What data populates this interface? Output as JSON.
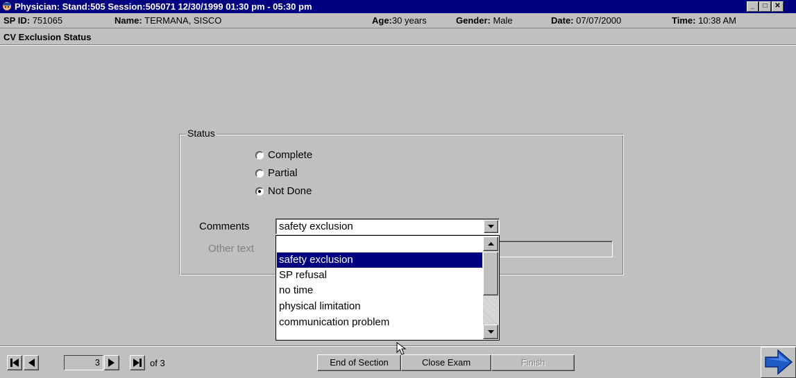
{
  "window": {
    "title": "Physician: Stand:505 Session:505071 12/30/1999 01:30 pm - 05:30 pm",
    "buttons": {
      "minimize": "_",
      "maximize": "□",
      "close": "✕"
    }
  },
  "info": {
    "sp_id_label": "SP ID:",
    "sp_id": "751065",
    "name_label": "Name:",
    "name": "TERMANA, SISCO",
    "age_label": "Age:",
    "age": "30 years",
    "gender_label": "Gender:",
    "gender": "Male",
    "date_label": "Date:",
    "date": "07/07/2000",
    "time_label": "Time:",
    "time": "10:38 AM"
  },
  "section": {
    "title": "CV Exclusion Status"
  },
  "status": {
    "legend": "Status",
    "options": [
      {
        "label": "Complete",
        "checked": false
      },
      {
        "label": "Partial",
        "checked": false
      },
      {
        "label": "Not Done",
        "checked": true
      }
    ]
  },
  "comments": {
    "label": "Comments",
    "value": "safety exclusion",
    "options": [
      "",
      "safety exclusion",
      "SP refusal",
      "no time",
      "physical limitation",
      "communication problem"
    ],
    "selected_index": 1
  },
  "other_text": {
    "label": "Other text"
  },
  "navigation": {
    "page": "3",
    "of_label": "of 3"
  },
  "commands": {
    "end_section": "End of Section",
    "close_exam": "Close Exam",
    "finish": "Finish"
  },
  "colors": {
    "titlebar": "#000080",
    "selection": "#000080",
    "face": "#c0c0c0",
    "next_arrow": "#1e5bc6"
  }
}
